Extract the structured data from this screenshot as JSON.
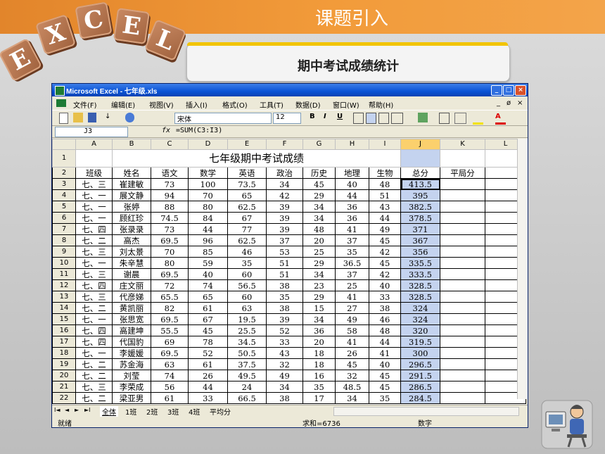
{
  "slide": {
    "title": "课题引入",
    "subtitle": "期中考试成绩统计",
    "logo_letters": [
      "E",
      "X",
      "C",
      "E",
      "L"
    ]
  },
  "window": {
    "title": "Microsoft Excel - 七年级.xls",
    "controls": [
      "_",
      "□",
      "×"
    ]
  },
  "menu": [
    "文件(F)",
    "编辑(E)",
    "视图(V)",
    "插入(I)",
    "格式(O)",
    "工具(T)",
    "数据(D)",
    "窗口(W)",
    "帮助(H)"
  ],
  "menu_right": [
    "_",
    "ø",
    "×"
  ],
  "toolbar": {
    "font_name": "宋体",
    "font_size": "12",
    "bold": "B",
    "italic": "I",
    "underline": "U"
  },
  "formula_bar": {
    "name_box": "J3",
    "fx": "fx",
    "formula": "=SUM(C3:I3)"
  },
  "sheet": {
    "columns": [
      "A",
      "B",
      "C",
      "D",
      "E",
      "F",
      "G",
      "H",
      "I",
      "J",
      "K",
      "L"
    ],
    "selected_column": "J",
    "title_row": {
      "row": "1",
      "text": "七年级期中考试成绩"
    },
    "header_row": {
      "row": "2",
      "cells": [
        "班级",
        "姓名",
        "语文",
        "数学",
        "英语",
        "政治",
        "历史",
        "地理",
        "生物",
        "总分",
        "平局分"
      ]
    },
    "rows": [
      {
        "row": "3",
        "cells": [
          "七、三",
          "崔建敏",
          "73",
          "100",
          "73.5",
          "34",
          "45",
          "40",
          "48",
          "413.5"
        ]
      },
      {
        "row": "4",
        "cells": [
          "七、一",
          "展文静",
          "94",
          "70",
          "65",
          "42",
          "29",
          "44",
          "51",
          "395"
        ]
      },
      {
        "row": "5",
        "cells": [
          "七、一",
          "张婷",
          "88",
          "80",
          "62.5",
          "39",
          "34",
          "36",
          "43",
          "382.5"
        ]
      },
      {
        "row": "6",
        "cells": [
          "七、一",
          "顾红珍",
          "74.5",
          "84",
          "67",
          "39",
          "34",
          "36",
          "44",
          "378.5"
        ]
      },
      {
        "row": "7",
        "cells": [
          "七、四",
          "张录录",
          "73",
          "44",
          "77",
          "39",
          "48",
          "41",
          "49",
          "371"
        ]
      },
      {
        "row": "8",
        "cells": [
          "七、二",
          "高杰",
          "69.5",
          "96",
          "62.5",
          "37",
          "20",
          "37",
          "45",
          "367"
        ]
      },
      {
        "row": "9",
        "cells": [
          "七、三",
          "刘太景",
          "70",
          "85",
          "46",
          "53",
          "25",
          "35",
          "42",
          "356"
        ]
      },
      {
        "row": "10",
        "cells": [
          "七、一",
          "朱辛慧",
          "80",
          "59",
          "35",
          "51",
          "29",
          "36.5",
          "45",
          "335.5"
        ]
      },
      {
        "row": "11",
        "cells": [
          "七、三",
          "谢晨",
          "69.5",
          "40",
          "60",
          "51",
          "34",
          "37",
          "42",
          "333.5"
        ]
      },
      {
        "row": "12",
        "cells": [
          "七、四",
          "庄文丽",
          "72",
          "74",
          "56.5",
          "38",
          "23",
          "25",
          "40",
          "328.5"
        ]
      },
      {
        "row": "13",
        "cells": [
          "七、三",
          "代彦娣",
          "65.5",
          "65",
          "60",
          "35",
          "29",
          "41",
          "33",
          "328.5"
        ]
      },
      {
        "row": "14",
        "cells": [
          "七、二",
          "黄凯丽",
          "82",
          "61",
          "63",
          "38",
          "15",
          "27",
          "38",
          "324"
        ]
      },
      {
        "row": "15",
        "cells": [
          "七、一",
          "张思宽",
          "69.5",
          "67",
          "19.5",
          "39",
          "34",
          "49",
          "46",
          "324"
        ]
      },
      {
        "row": "16",
        "cells": [
          "七、四",
          "高建坤",
          "55.5",
          "45",
          "25.5",
          "52",
          "36",
          "58",
          "48",
          "320"
        ]
      },
      {
        "row": "17",
        "cells": [
          "七、四",
          "代国豹",
          "69",
          "78",
          "34.5",
          "33",
          "20",
          "41",
          "44",
          "319.5"
        ]
      },
      {
        "row": "18",
        "cells": [
          "七、一",
          "李媛媛",
          "69.5",
          "52",
          "50.5",
          "43",
          "18",
          "26",
          "41",
          "300"
        ]
      },
      {
        "row": "19",
        "cells": [
          "七、二",
          "苏金海",
          "63",
          "61",
          "37.5",
          "32",
          "18",
          "45",
          "40",
          "296.5"
        ]
      },
      {
        "row": "20",
        "cells": [
          "七、二",
          "刘莹",
          "74",
          "26",
          "49.5",
          "49",
          "16",
          "32",
          "45",
          "291.5"
        ]
      },
      {
        "row": "21",
        "cells": [
          "七、三",
          "李荣成",
          "56",
          "44",
          "24",
          "34",
          "35",
          "48.5",
          "45",
          "286.5"
        ]
      },
      {
        "row": "22",
        "cells": [
          "七、二",
          "梁亚男",
          "61",
          "33",
          "66.5",
          "38",
          "17",
          "34",
          "35",
          "284.5"
        ]
      }
    ]
  },
  "sheet_tabs": [
    "全体",
    "1班",
    "2班",
    "3班",
    "4班",
    "平均分"
  ],
  "sheet_nav": [
    "I◄",
    "◄",
    "►",
    "►I"
  ],
  "status": {
    "ready": "就绪",
    "sum": "求和=6736",
    "mode": "数字"
  }
}
